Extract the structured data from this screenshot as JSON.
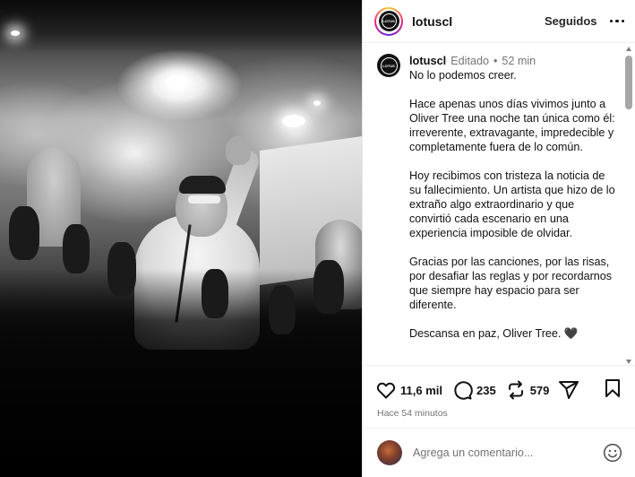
{
  "post": {
    "image_alt": "Concert photo in black and white"
  },
  "header": {
    "username": "lotuscl",
    "follow_label": "Seguidos",
    "logo_text": "LOTUS"
  },
  "caption": {
    "username": "lotuscl",
    "edited_label": "Editado",
    "separator": "•",
    "time": "52 min",
    "paragraphs": [
      "No lo podemos creer.",
      "Hace apenas unos días vivimos junto a Oliver Tree una noche tan única como él: irreverente, extravagante, impredecible y completamente fuera de lo común.",
      "Hoy recibimos con tristeza la noticia de su fallecimiento. Un artista que hizo de lo extraño algo extraordinario y que convirtió cada escenario en una experiencia imposible de olvidar.",
      "Gracias por las canciones, por las risas, por desafiar las reglas y por recordarnos que siempre hay espacio para ser diferente.",
      "Descansa en paz, Oliver Tree. 🖤"
    ]
  },
  "actions": {
    "likes": "11,6 mil",
    "comments": "235",
    "reposts": "579"
  },
  "posted": "Hace 54 minutos",
  "comment_box": {
    "placeholder": "Agrega un comentario..."
  },
  "colors": {
    "text": "#111111",
    "muted": "#737373",
    "divider": "#efefef"
  },
  "icons": [
    "heart-icon",
    "comment-icon",
    "repost-icon",
    "share-icon",
    "bookmark-icon",
    "emoji-icon",
    "more-icon"
  ]
}
